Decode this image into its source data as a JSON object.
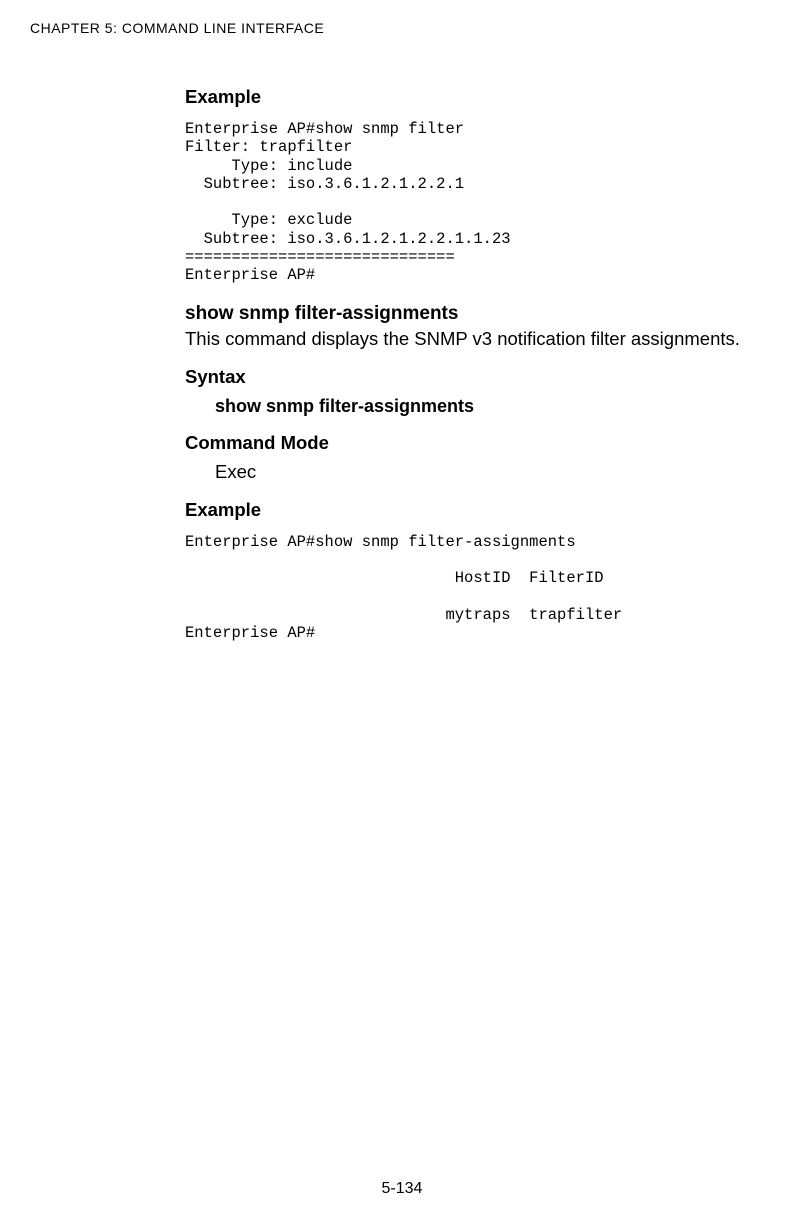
{
  "running_header": "CHAPTER 5: COMMAND LINE INTERFACE",
  "section1": {
    "heading": "Example",
    "code": "Enterprise AP#show snmp filter\nFilter: trapfilter\n     Type: include\n  Subtree: iso.3.6.1.2.1.2.2.1\n\n     Type: exclude\n  Subtree: iso.3.6.1.2.1.2.2.1.1.23\n=============================\nEnterprise AP#"
  },
  "section2": {
    "cmd": "show snmp filter-assignments",
    "desc": "This command displays the SNMP v3 notification filter assignments.",
    "syntax_heading": "Syntax",
    "syntax_cmd": "show snmp filter-assignments",
    "mode_heading": "Command Mode",
    "mode_value": "Exec",
    "example_heading": "Example",
    "code": "Enterprise AP#show snmp filter-assignments\n\n                             HostID  FilterID\n\n                            mytraps  trapfilter\nEnterprise AP#"
  },
  "page_num": "5-134"
}
